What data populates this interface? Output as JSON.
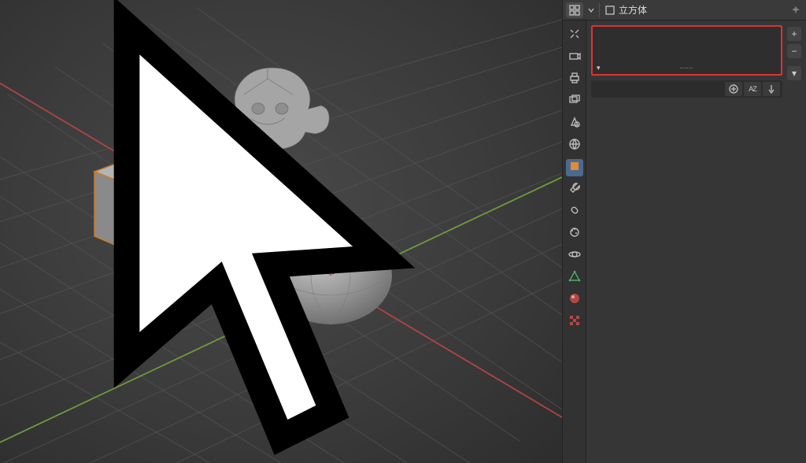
{
  "header": {
    "object_name": "立方体",
    "editor_icon": "properties-icon",
    "dropdown_icon": "chevron-down-icon",
    "data_icon": "object-data-icon",
    "pin_icon": "pin-icon"
  },
  "property_tabs": [
    {
      "id": "tool",
      "icon": "wrench-screwdriver-icon",
      "active": false
    },
    {
      "id": "render",
      "icon": "camera-back-icon",
      "active": false
    },
    {
      "id": "output",
      "icon": "printer-icon",
      "active": false
    },
    {
      "id": "view-layer",
      "icon": "image-stack-icon",
      "active": false
    },
    {
      "id": "scene",
      "icon": "cone-sphere-icon",
      "active": false
    },
    {
      "id": "world",
      "icon": "globe-icon",
      "active": false
    },
    {
      "id": "object",
      "icon": "square-icon",
      "active": true
    },
    {
      "id": "modifiers",
      "icon": "wrench-icon",
      "active": false
    },
    {
      "id": "constraints",
      "icon": "chain-link-icon",
      "active": false
    },
    {
      "id": "particles",
      "icon": "particles-icon",
      "active": false
    },
    {
      "id": "physics",
      "icon": "orbit-icon",
      "active": false
    },
    {
      "id": "data",
      "icon": "mesh-triangle-icon",
      "active": false
    },
    {
      "id": "material",
      "icon": "material-sphere-icon",
      "active": false
    },
    {
      "id": "texture",
      "icon": "checker-icon",
      "active": false
    }
  ],
  "modifier_panel": {
    "add_label": "+",
    "remove_label": "−",
    "menu_label": "▾",
    "toolbar": {
      "add_icon": "plus-circle-icon",
      "sort_icon": "az-sort-icon",
      "sort_text": "A͏Z",
      "down_icon": "arrow-down-icon"
    }
  },
  "viewport": {
    "objects": [
      {
        "name": "Cube",
        "selected": true
      },
      {
        "name": "Suzanne",
        "selected": false
      },
      {
        "name": "Sphere",
        "selected": false
      }
    ],
    "axes": [
      "X",
      "Y"
    ]
  },
  "colors": {
    "selection": "#c87a2a",
    "axis_x": "#b04444",
    "axis_y": "#6f9a3c",
    "highlight_box": "#d33333",
    "active_tab": "#4b6a8f"
  }
}
